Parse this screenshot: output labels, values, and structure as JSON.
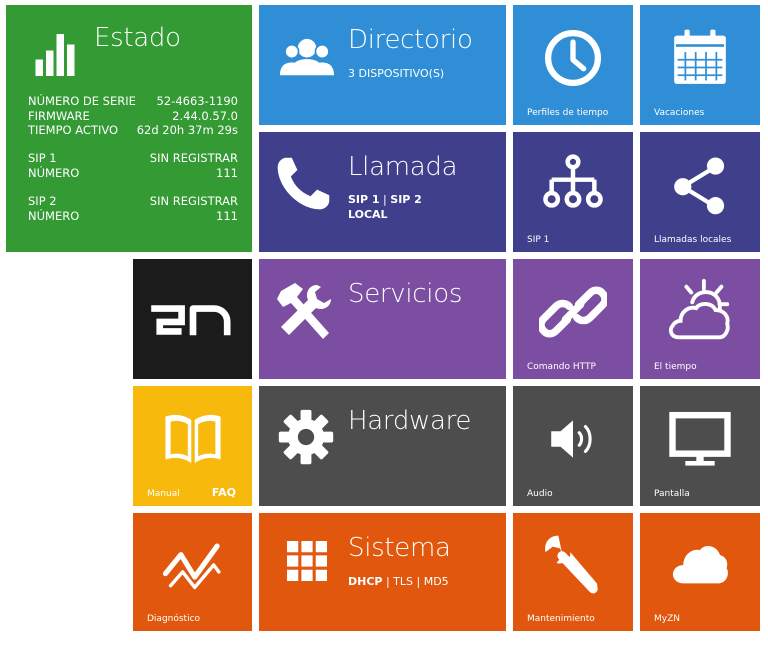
{
  "estado": {
    "title": "Estado",
    "serial_label": "NÚMERO DE SERIE",
    "serial_value": "52-4663-1190",
    "firmware_label": "FIRMWARE",
    "firmware_value": "2.44.0.57.0",
    "uptime_label": "TIEMPO ACTIVO",
    "uptime_value": "62d 20h 37m 29s",
    "sip1_label": "SIP 1",
    "sip1_status": "SIN REGISTRAR",
    "sip1_number_label": "NÚMERO",
    "sip1_number": "111",
    "sip2_label": "SIP 2",
    "sip2_status": "SIN REGISTRAR",
    "sip2_number_label": "NÚMERO",
    "sip2_number": "111"
  },
  "directorio": {
    "title": "Directorio",
    "subtitle": "3 DISPOSITIVO(S)"
  },
  "llamada": {
    "title": "Llamada",
    "sip1": "SIP 1",
    "sep": " | ",
    "sip2": "SIP 2",
    "local": "LOCAL"
  },
  "servicios": {
    "title": "Servicios"
  },
  "hardware": {
    "title": "Hardware"
  },
  "sistema": {
    "title": "Sistema",
    "dhcp": "DHCP",
    "rest": " | TLS | MD5"
  },
  "tiles": {
    "perfiles": "Perfiles de tiempo",
    "vacaciones": "Vacaciones",
    "sip1": "SIP 1",
    "llamadas_locales": "Llamadas locales",
    "logo": "2N",
    "comando_http": "Comando HTTP",
    "tiempo": "El tiempo",
    "manual": "Manual",
    "faq": "FAQ",
    "audio": "Audio",
    "pantalla": "Pantalla",
    "diagnostico": "Diagnóstico",
    "mantenimiento": "Mantenimiento",
    "myzn": "MyZN"
  },
  "colors": {
    "green": "#339a34",
    "blue": "#2f8ed6",
    "indigo": "#3f3f8c",
    "purple": "#7b4ea1",
    "black": "#1b1b1b",
    "yellow": "#f6b90c",
    "gray": "#4d4d4d",
    "orange": "#e0570d"
  },
  "icons": {
    "estado": "bar-chart-icon",
    "directorio": "users-icon",
    "llamada": "phone-icon",
    "servicios": "tools-icon",
    "hardware": "gear-icon",
    "sistema": "grid-icon",
    "perfiles": "clock-icon",
    "vacaciones": "calendar-icon",
    "sip1": "hierarchy-icon",
    "llamadas_locales": "share-icon",
    "comando_http": "link-icon",
    "tiempo": "weather-icon",
    "manual": "book-icon",
    "audio": "speaker-icon",
    "pantalla": "monitor-icon",
    "diagnostico": "trend-icon",
    "mantenimiento": "wrench-icon",
    "myzn": "cloud-icon"
  }
}
